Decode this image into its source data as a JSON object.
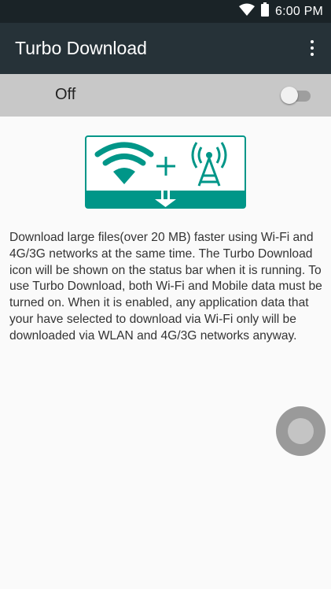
{
  "status_bar": {
    "time": "6:00 PM",
    "icons": [
      "wifi-icon",
      "battery-icon"
    ]
  },
  "app_bar": {
    "title": "Turbo Download",
    "menu_icon": "overflow-menu-icon"
  },
  "switch": {
    "label": "Off",
    "state": "off"
  },
  "illustration": {
    "icons": [
      "wifi-icon",
      "plus-icon",
      "cell-tower-icon",
      "download-arrow-icon"
    ],
    "accent_color": "#009688"
  },
  "description": "Download large files(over 20 MB) faster using Wi-Fi and 4G/3G networks at the same time. The Turbo Download icon will be shown on the status bar when it is running. To use Turbo Download, both Wi-Fi and Mobile data must be turned on. When it is enabled, any application data that your have selected to download via Wi-Fi only will be downloaded via WLAN and 4G/3G networks anyway.",
  "colors": {
    "app_bar": "#263238",
    "status_bar": "#1a2327",
    "switch_row": "#c8c8c8",
    "accent": "#009688"
  }
}
